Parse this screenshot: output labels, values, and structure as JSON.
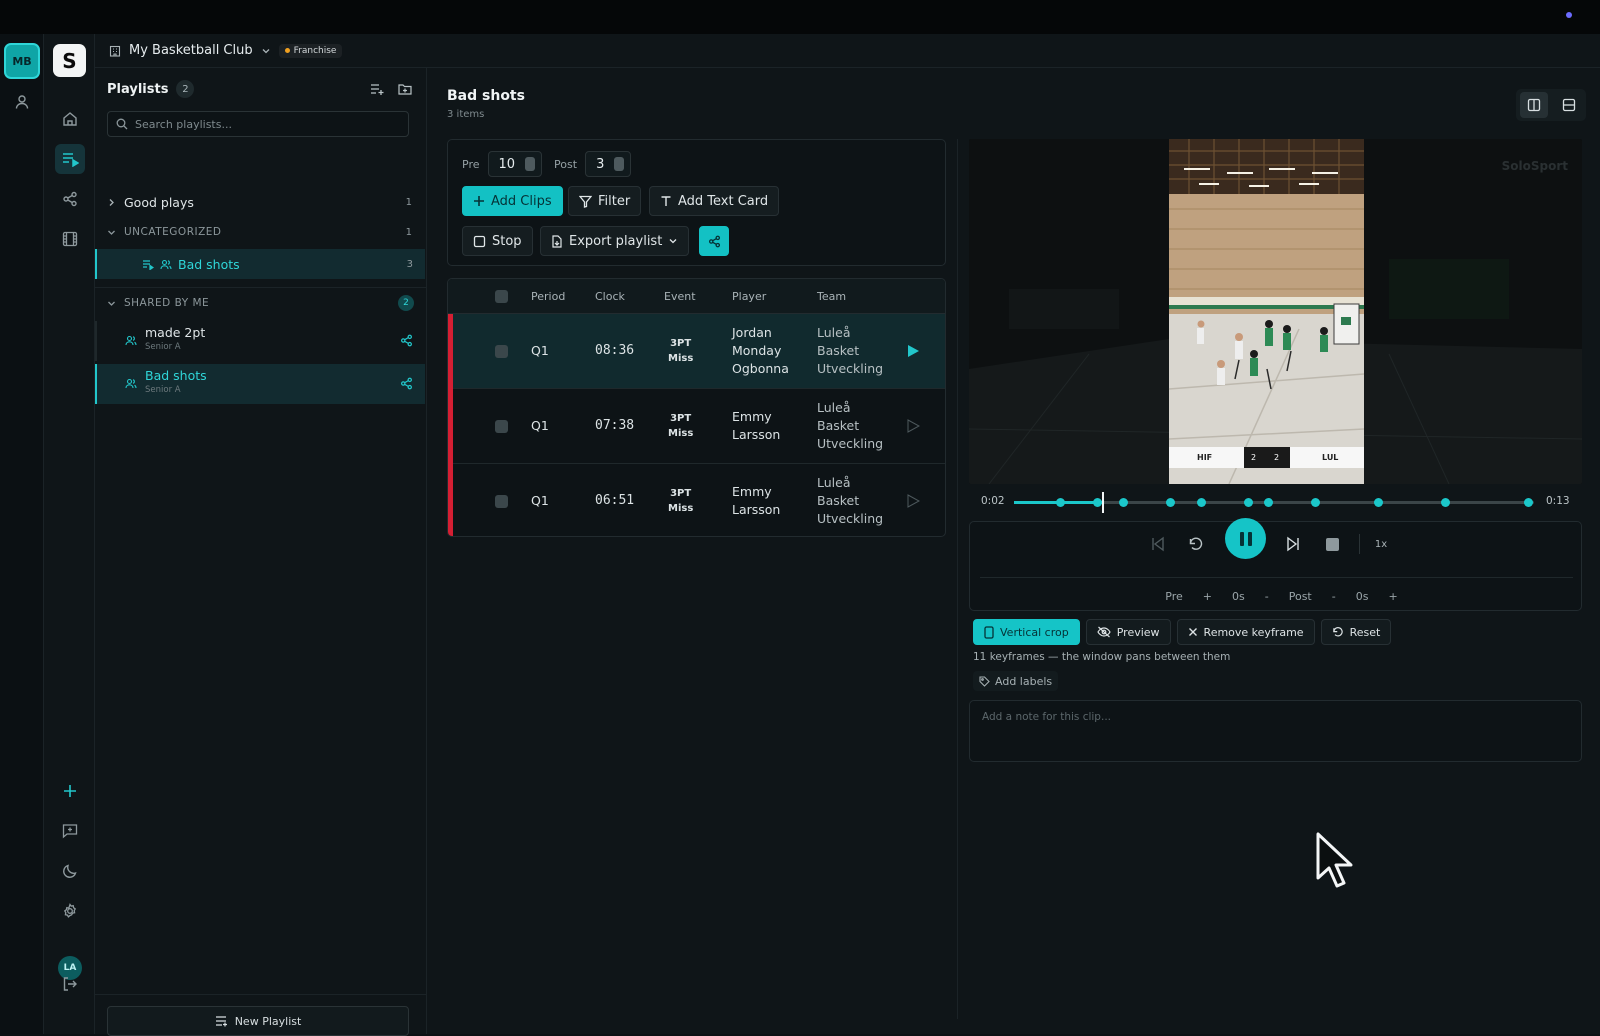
{
  "workspace": {
    "initials": "MB",
    "logo": "S",
    "user_initials": "LA"
  },
  "header": {
    "club_name": "My Basketball Club",
    "plan_badge": "Franchise"
  },
  "sidebar": {
    "title": "Playlists",
    "count": "2",
    "search_placeholder": "Search playlists...",
    "folders": [
      {
        "label": "Good plays",
        "count": "1"
      }
    ],
    "uncategorized": {
      "label": "UNCATEGORIZED",
      "count": "1",
      "items": [
        {
          "name": "Bad shots",
          "count": "3"
        }
      ]
    },
    "shared": {
      "label": "SHARED BY ME",
      "count": "2",
      "items": [
        {
          "name": "made 2pt",
          "sub": "Senior A"
        },
        {
          "name": "Bad shots",
          "sub": "Senior A"
        }
      ]
    },
    "new_playlist_label": "New Playlist"
  },
  "main": {
    "title": "Bad shots",
    "subtitle": "3 items",
    "pre_label": "Pre",
    "pre_value": "10",
    "post_label": "Post",
    "post_value": "3",
    "buttons": {
      "add_clips": "Add Clips",
      "filter": "Filter",
      "add_text_card": "Add Text Card",
      "stop": "Stop",
      "export": "Export playlist"
    },
    "table": {
      "columns": [
        "Period",
        "Clock",
        "Event",
        "Player",
        "Team"
      ],
      "rows": [
        {
          "period": "Q1",
          "clock": "08:36",
          "event1": "3PT",
          "event2": "Miss",
          "player": [
            "Jordan",
            "Monday",
            "Ogbonna"
          ],
          "team": [
            "Luleå",
            "Basket",
            "Utveckling"
          ]
        },
        {
          "period": "Q1",
          "clock": "07:38",
          "event1": "3PT",
          "event2": "Miss",
          "player": [
            "Emmy",
            "Larsson"
          ],
          "team": [
            "Luleå",
            "Basket",
            "Utveckling"
          ]
        },
        {
          "period": "Q1",
          "clock": "06:51",
          "event1": "3PT",
          "event2": "Miss",
          "player": [
            "Emmy",
            "Larsson"
          ],
          "team": [
            "Luleå",
            "Basket",
            "Utveckling"
          ]
        }
      ]
    }
  },
  "video": {
    "watermark": "SoloSport",
    "scoreboard": {
      "home": "HIF",
      "home_score": "2",
      "away_score": "2",
      "away": "LUL"
    },
    "time_current": "0:02",
    "time_total": "0:13",
    "progress": 0.17,
    "keyframes": [
      0.09,
      0.16,
      0.21,
      0.3,
      0.36,
      0.45,
      0.49,
      0.58,
      0.7,
      0.83,
      0.99
    ]
  },
  "player": {
    "speed": "1x",
    "pre_label": "Pre",
    "pre_plus": "+",
    "pre_value": "0s",
    "pre_minus": "-",
    "post_label": "Post",
    "post_minus": "-",
    "post_value": "0s",
    "post_plus": "+"
  },
  "crop": {
    "vertical_crop": "Vertical crop",
    "preview": "Preview",
    "remove_keyframe": "Remove keyframe",
    "reset": "Reset",
    "note": "11 keyframes — the window pans between them",
    "add_labels": "Add labels",
    "note_placeholder": "Add a note for this clip..."
  },
  "colors": {
    "accent": "#15c4c7",
    "miss": "#d51f33",
    "background": "#0f1518"
  }
}
